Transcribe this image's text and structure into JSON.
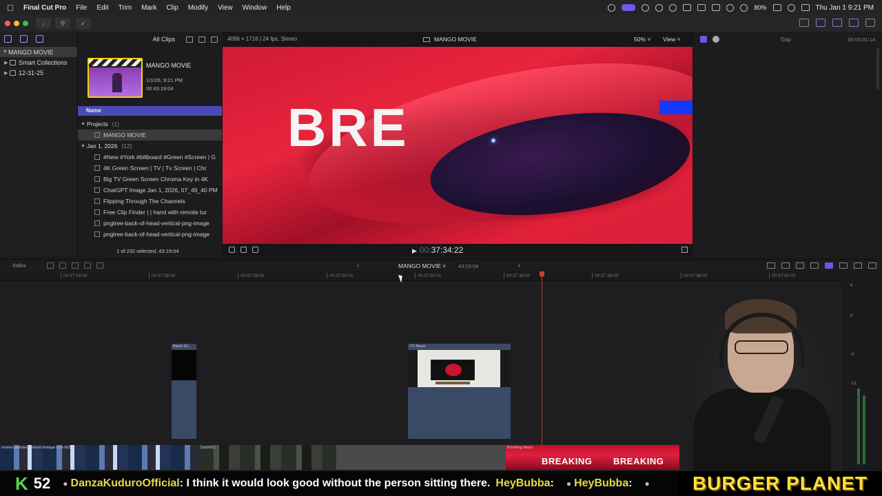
{
  "menubar": {
    "app": "Final Cut Pro",
    "items": [
      "File",
      "Edit",
      "Trim",
      "Mark",
      "Clip",
      "Modify",
      "View",
      "Window",
      "Help"
    ],
    "battery": "80%",
    "clock": "Thu Jan 1  9:21 PM"
  },
  "sidebar": {
    "library": "MANGO MOVIE",
    "items": [
      "Smart Collections",
      "12-31-25"
    ]
  },
  "browser": {
    "filter": "All Clips",
    "event_title": "MANGO MOVIE",
    "event_date": "1/1/26, 9:21 PM",
    "event_duration": "00:43:19:04",
    "column_name": "Name",
    "projects_group": "Projects",
    "projects_count": "(1)",
    "project_item": "MANGO MOVIE",
    "date_group": "Jan 1, 2026",
    "date_count": "(12)",
    "clips": [
      "#New #York #billboard #Green #Screen | G",
      "4K Green Screen  |  TV  |  Tv Screen  |  Chr",
      "Big TV Green Screen Chroma Key in 4K",
      "ChatGPT Image Jan 1, 2026, 07_49_40 PM",
      "Flipping Through The Channels",
      "Free Clip Finder  |  |  hand with remote tur",
      "pngtree-back-of-head-vertical-png-image",
      "pngtree-back-of-head-vertical-png-image"
    ],
    "selection_status": "1 of 232 selected, 43:19:04"
  },
  "viewer": {
    "format": "4096 × 1716 | 24 fps, Stereo",
    "title": "MANGO MOVIE",
    "zoom": "50%",
    "view_menu": "View",
    "frame_text": "BRE",
    "timecode_dim": "00:",
    "timecode": "37:34:22"
  },
  "inspector": {
    "label": "Gap",
    "time": "00:00:01:14"
  },
  "timeline": {
    "index": "Index",
    "project": "MANGO MOVIE",
    "duration": "43:19:04",
    "ruler": [
      "00:37:24:00",
      "00:37:26:00",
      "00:37:28:00",
      "00:37:30:00",
      "00:37:32:00",
      "00:37:34:00",
      "00:37:36:00",
      "00:37:38:00",
      "00:37:40:00"
    ],
    "clip_black": "Black 10...",
    "clip_tv": "TV News",
    "story_a": "movies arrested mclove footage cctv-002",
    "story_b": "Clip0062",
    "story_c": "Breaking News",
    "breaking": "BREAKING",
    "meters": [
      "6",
      "0",
      "-6",
      "-12"
    ]
  },
  "ticker": {
    "k": "K",
    "count": "52",
    "user1": "DanzaKuduroOfficial",
    "msg1": ": I think it would look good without the person sitting there.",
    "user2": "HeyBubba",
    "msg2": ":",
    "user3": "HeyBubba",
    "msg3": ":",
    "brand": "BURGER PLANET"
  }
}
